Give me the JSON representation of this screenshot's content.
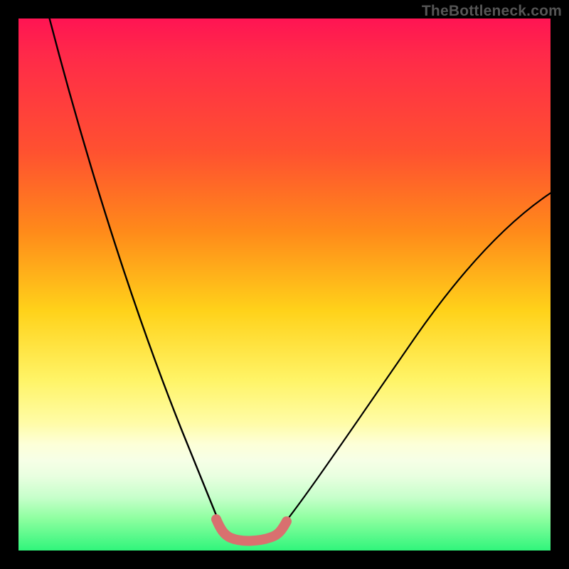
{
  "watermark": {
    "text": "TheBottleneck.com"
  },
  "colors": {
    "background": "#000000",
    "watermark": "#555555",
    "curve_stroke": "#000000",
    "highlight_stroke": "#d9706f",
    "gradient_stops": [
      "#ff1453",
      "#ff2a49",
      "#ff5130",
      "#ff8a1a",
      "#ffd21a",
      "#fff467",
      "#fffca6",
      "#fdffd8",
      "#f6ffe6",
      "#e9ffe0",
      "#c7ffcb",
      "#8effa0",
      "#30f57b"
    ]
  },
  "chart_data": {
    "type": "line",
    "title": "",
    "xlabel": "",
    "ylabel": "",
    "xlim": [
      0,
      1
    ],
    "ylim": [
      0,
      1
    ],
    "note": "Axes are unlabeled in the source image; values are normalized 0–1 fractions of the plot area. y=1 is the top edge, y=0 the bottom edge.",
    "series": [
      {
        "name": "left-branch",
        "x": [
          0.055,
          0.1,
          0.15,
          0.2,
          0.25,
          0.3,
          0.33,
          0.36,
          0.385
        ],
        "y": [
          1.0,
          0.82,
          0.65,
          0.48,
          0.33,
          0.2,
          0.13,
          0.07,
          0.033
        ]
      },
      {
        "name": "valley-floor",
        "x": [
          0.385,
          0.415,
          0.45,
          0.485
        ],
        "y": [
          0.033,
          0.024,
          0.024,
          0.033
        ]
      },
      {
        "name": "right-branch",
        "x": [
          0.485,
          0.52,
          0.57,
          0.63,
          0.7,
          0.78,
          0.87,
          0.94,
          1.0
        ],
        "y": [
          0.033,
          0.06,
          0.12,
          0.2,
          0.3,
          0.41,
          0.53,
          0.615,
          0.68
        ]
      }
    ],
    "annotations": [
      {
        "name": "valley-highlight",
        "x_range": [
          0.37,
          0.5
        ],
        "y_approx": 0.03
      }
    ]
  }
}
